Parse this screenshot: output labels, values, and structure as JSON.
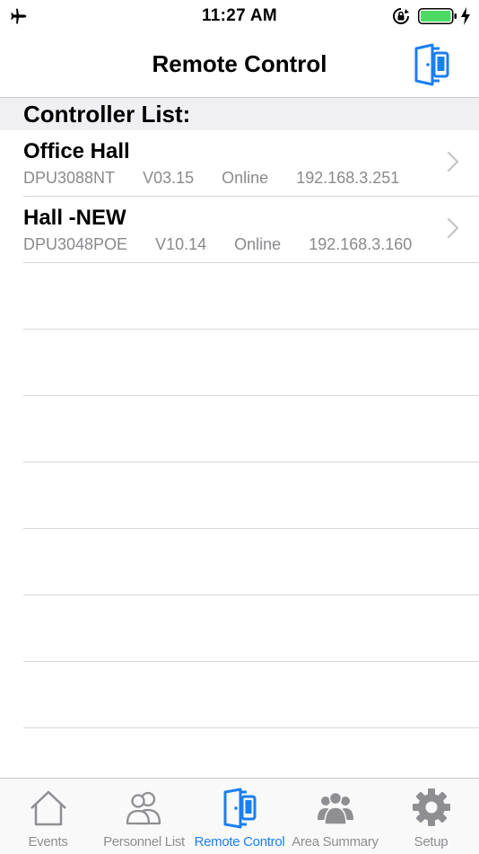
{
  "status_bar": {
    "time": "11:27 AM",
    "icons": [
      "airplane-mode-icon",
      "orientation-lock-icon",
      "battery-icon",
      "charging-icon"
    ],
    "battery_color": "#4cd964"
  },
  "nav": {
    "title": "Remote Control",
    "action_icon": "door-phone-icon",
    "accent_color": "#1a7ff0"
  },
  "section": {
    "header": "Controller List:"
  },
  "controllers": [
    {
      "name": "Office Hall",
      "model": "DPU3088NT",
      "version": "V03.15",
      "status": "Online",
      "ip": "192.168.3.251"
    },
    {
      "name": "Hall -NEW",
      "model": "DPU3048POE",
      "version": "V10.14",
      "status": "Online",
      "ip": "192.168.3.160"
    }
  ],
  "tabs": [
    {
      "label": "Events",
      "icon": "home-icon",
      "active": false
    },
    {
      "label": "Personnel List",
      "icon": "people-icon",
      "active": false
    },
    {
      "label": "Remote Control",
      "icon": "door-phone-icon",
      "active": true
    },
    {
      "label": "Area Summary",
      "icon": "group-icon",
      "active": false
    },
    {
      "label": "Setup",
      "icon": "gear-icon",
      "active": false
    }
  ]
}
